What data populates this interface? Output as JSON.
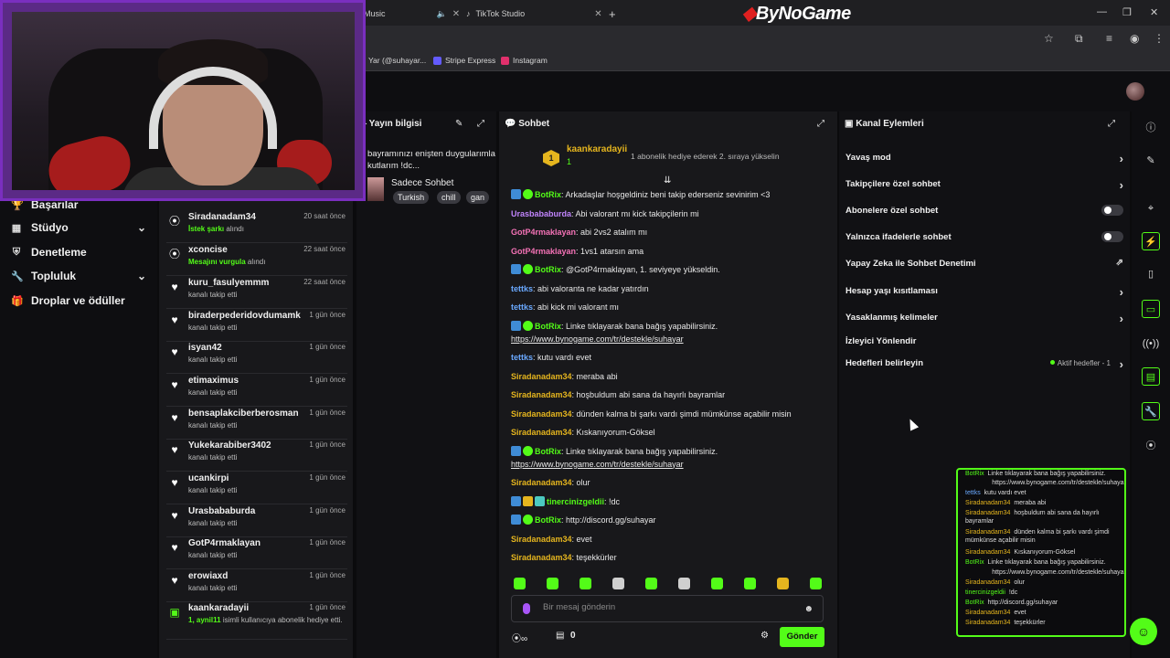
{
  "browser": {
    "tabs": [
      {
        "label": "Music"
      },
      {
        "label": "TikTok Studio"
      }
    ],
    "logo": "ByNoGame",
    "bookmarks": [
      {
        "label": "Yar (@suhayar...",
        "color": "#888"
      },
      {
        "label": "Stripe Express",
        "color": "#635bff"
      },
      {
        "label": "Instagram",
        "color": "#e1306c"
      }
    ]
  },
  "leftnav": {
    "items": [
      {
        "label": "Başarılar"
      },
      {
        "label": "Stüdyo"
      },
      {
        "label": "Denetleme"
      },
      {
        "label": "Topluluk"
      },
      {
        "label": "Droplar ve ödüller"
      }
    ]
  },
  "feed": [
    {
      "name": "Siradanadam34",
      "time": "20 saat önce",
      "hl": "İstek şarkı",
      "sub": " alındı",
      "icon": "points-icon"
    },
    {
      "name": "xconcise",
      "time": "22 saat önce",
      "hl": "Mesajını vurgula",
      "sub": " alındı",
      "icon": "points-icon"
    },
    {
      "name": "kuru_fasulyemmm",
      "time": "22 saat önce",
      "hl": "",
      "sub": "kanalı takip etti",
      "icon": "heart-icon"
    },
    {
      "name": "biraderpederidovdumamk",
      "time": "1 gün önce",
      "hl": "",
      "sub": "kanalı takip etti",
      "icon": "heart-icon"
    },
    {
      "name": "isyan42",
      "time": "1 gün önce",
      "hl": "",
      "sub": "kanalı takip etti",
      "icon": "heart-icon"
    },
    {
      "name": "etimaximus",
      "time": "1 gün önce",
      "hl": "",
      "sub": "kanalı takip etti",
      "icon": "heart-icon"
    },
    {
      "name": "bensaplakciberberosman",
      "time": "1 gün önce",
      "hl": "",
      "sub": "kanalı takip etti",
      "icon": "heart-icon"
    },
    {
      "name": "Yukekarabiber3402",
      "time": "1 gün önce",
      "hl": "",
      "sub": "kanalı takip etti",
      "icon": "heart-icon"
    },
    {
      "name": "ucankirpi",
      "time": "1 gün önce",
      "hl": "",
      "sub": "kanalı takip etti",
      "icon": "heart-icon"
    },
    {
      "name": "Urasbababurda",
      "time": "1 gün önce",
      "hl": "",
      "sub": "kanalı takip etti",
      "icon": "heart-icon"
    },
    {
      "name": "GotP4rmaklayan",
      "time": "1 gün önce",
      "hl": "",
      "sub": "kanalı takip etti",
      "icon": "heart-icon"
    },
    {
      "name": "erowiaxd",
      "time": "1 gün önce",
      "hl": "",
      "sub": "kanalı takip etti",
      "icon": "heart-icon"
    },
    {
      "name": "kaankaradayii",
      "time": "1 gün önce",
      "hl": "1, aynil11",
      "sub": " isimli kullanıcıya abonelik hediye etti.",
      "icon": "gift-icon"
    }
  ],
  "info": {
    "header": "Yayın bilgisi",
    "title": "bayramınızı enişten duygularımla kutlarım !dc...",
    "category": "Sadece Sohbet",
    "tags": [
      "Turkish",
      "chill",
      "gan"
    ]
  },
  "chat": {
    "header": "Sohbet",
    "pinned": {
      "name": "kaankaradayii",
      "count": "1",
      "message": "1 abonelik hediye ederek 2. sıraya yükselin"
    },
    "messages": [
      {
        "user": "BotRix",
        "color": "#53fc18",
        "badges": [
          "b",
          "g"
        ],
        "text": ": Arkadaşlar hoşgeldiniz beni takip ederseniz sevinirim <3"
      },
      {
        "user": "Urasbababurda",
        "color": "#c084fc",
        "badges": [],
        "text": ": Abi valorant mı kick takipçilerin mi"
      },
      {
        "user": "GotP4rmaklayan",
        "color": "#f472b6",
        "badges": [],
        "text": ": abi 2vs2 atalım mı"
      },
      {
        "user": "GotP4rmaklayan",
        "color": "#f472b6",
        "badges": [],
        "text": ": 1vs1 atarsın ama"
      },
      {
        "user": "BotRix",
        "color": "#53fc18",
        "badges": [
          "b",
          "g"
        ],
        "text": ": @GotP4rmaklayan, 1. seviyeye yükseldin."
      },
      {
        "user": "tettks",
        "color": "#6aa9ff",
        "badges": [],
        "text": ": abi valoranta ne kadar yatırdın"
      },
      {
        "user": "tettks",
        "color": "#6aa9ff",
        "badges": [],
        "text": ": abi kick mi valorant mı"
      },
      {
        "user": "BotRix",
        "color": "#53fc18",
        "badges": [
          "b",
          "g"
        ],
        "text": ": Linke tıklayarak bana bağış yapabilirsiniz.",
        "link": "https://www.bynogame.com/tr/destekle/suhayar"
      },
      {
        "user": "tettks",
        "color": "#6aa9ff",
        "badges": [],
        "text": ": kutu vardı evet"
      },
      {
        "user": "Siradanadam34",
        "color": "#e5b51e",
        "badges": [],
        "text": ": meraba abi"
      },
      {
        "user": "Siradanadam34",
        "color": "#e5b51e",
        "badges": [],
        "text": ": hoşbuldum abi sana da hayırlı bayramlar"
      },
      {
        "user": "Siradanadam34",
        "color": "#e5b51e",
        "badges": [],
        "text": ": dünden kalma bi şarkı vardı şimdi mümkünse açabilir misin"
      },
      {
        "user": "Siradanadam34",
        "color": "#e5b51e",
        "badges": [],
        "text": ": Kıskanıyorum-Göksel"
      },
      {
        "user": "BotRix",
        "color": "#53fc18",
        "badges": [
          "b",
          "g"
        ],
        "text": ": Linke tıklayarak bana bağış yapabilirsiniz.",
        "link": "https://www.bynogame.com/tr/destekle/suhayar"
      },
      {
        "user": "Siradanadam34",
        "color": "#e5b51e",
        "badges": [],
        "text": ": olur"
      },
      {
        "user": "tinercinizgeldii",
        "color": "#53fc18",
        "badges": [
          "b",
          "y",
          "c"
        ],
        "text": ": !dc"
      },
      {
        "user": "BotRix",
        "color": "#53fc18",
        "badges": [
          "b",
          "g"
        ],
        "text": ": http://discord.gg/suhayar"
      },
      {
        "user": "Siradanadam34",
        "color": "#e5b51e",
        "badges": [],
        "text": ": evet"
      },
      {
        "user": "Siradanadam34",
        "color": "#e5b51e",
        "badges": [],
        "text": ": teşekkürler"
      }
    ],
    "input_placeholder": "Bir mesaj gönderin",
    "points": "0",
    "send_label": "Gönder"
  },
  "actions": {
    "header": "Kanal Eylemleri",
    "items": [
      {
        "label": "Yavaş mod",
        "control": "chevron"
      },
      {
        "label": "Takipçilere özel sohbet",
        "control": "chevron"
      },
      {
        "label": "Abonelere özel sohbet",
        "control": "toggle"
      },
      {
        "label": "Yalnızca ifadelerle sohbet",
        "control": "toggle"
      },
      {
        "label": "Yapay Zeka ile Sohbet Denetimi",
        "control": "external"
      },
      {
        "label": "Hesap yaşı kısıtlaması",
        "control": "chevron"
      },
      {
        "label": "Yasaklanmış kelimeler",
        "control": "chevron"
      },
      {
        "label": "İzleyici Yönlendir",
        "control": "none"
      },
      {
        "label": "Hedefleri belirleyin",
        "control": "goals"
      }
    ],
    "goals_label": "Aktif hedefler - 1"
  },
  "overlay": [
    {
      "u": "BotRix",
      "cls": "ug",
      "t": "Linke tıklayarak bana bağış yapabilirsiniz."
    },
    {
      "u": "",
      "cls": "u",
      "t": "https://www.bynogame.com/tr/destekle/suhayar"
    },
    {
      "u": "tettks",
      "cls": "ub",
      "t": "kutu vardı evet"
    },
    {
      "u": "Siradanadam34",
      "cls": "u",
      "t": "meraba abi"
    },
    {
      "u": "Siradanadam34",
      "cls": "u",
      "t": "hoşbuldum abi sana da hayırlı bayramlar"
    },
    {
      "u": "Siradanadam34",
      "cls": "u",
      "t": "dünden kalma bi şarkı vardı şimdi mümkünse açabilir misin"
    },
    {
      "u": "Siradanadam34",
      "cls": "u",
      "t": "Kıskanıyorum-Göksel"
    },
    {
      "u": "BotRix",
      "cls": "ug",
      "t": "Linke tıklayarak bana bağış yapabilirsiniz."
    },
    {
      "u": "",
      "cls": "u",
      "t": "https://www.bynogame.com/tr/destekle/suhayar"
    },
    {
      "u": "Siradanadam34",
      "cls": "u",
      "t": "olur"
    },
    {
      "u": "tinercinizgeldii",
      "cls": "ug",
      "t": "!dc"
    },
    {
      "u": "BotRix",
      "cls": "ug",
      "t": "http://discord.gg/suhayar"
    },
    {
      "u": "Siradanadam34",
      "cls": "u",
      "t": "evet"
    },
    {
      "u": "Siradanadam34",
      "cls": "u",
      "t": "teşekkürler"
    }
  ]
}
